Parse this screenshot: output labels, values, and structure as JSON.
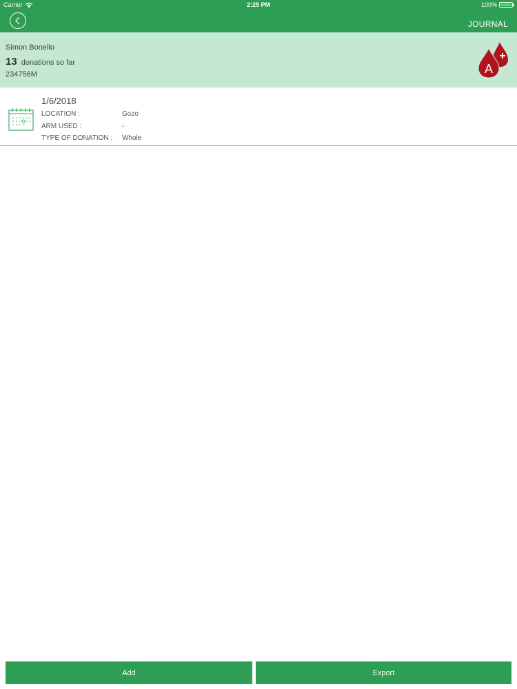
{
  "status_bar": {
    "carrier": "Carrier",
    "time": "2:25 PM",
    "battery": "100%",
    "battery_level": 1.0
  },
  "nav": {
    "title": "JOURNAL",
    "back_icon": "chevron-left-icon"
  },
  "profile": {
    "name": "Simon Bonello",
    "donation_count": "13",
    "donation_suffix": "donations so far",
    "id": "234756M",
    "blood_type_icon": "blood-drop-a-positive-icon",
    "blood_type_letter": "A",
    "blood_type_sign": "+"
  },
  "entries": [
    {
      "icon": "calendar-icon",
      "date": "1/6/2018",
      "location_label": "LOCATION :",
      "location_value": "Gozo",
      "arm_label": "ARM USED :",
      "arm_value": "-",
      "type_label": "TYPE OF DONATION :",
      "type_value": "Whole"
    }
  ],
  "buttons": {
    "add": "Add",
    "export": "Export"
  },
  "colors": {
    "primary_green": "#2e9e55",
    "header_bg": "#c5e8d3",
    "blood_red": "#b1131d",
    "battery_green": "#4cd964"
  }
}
